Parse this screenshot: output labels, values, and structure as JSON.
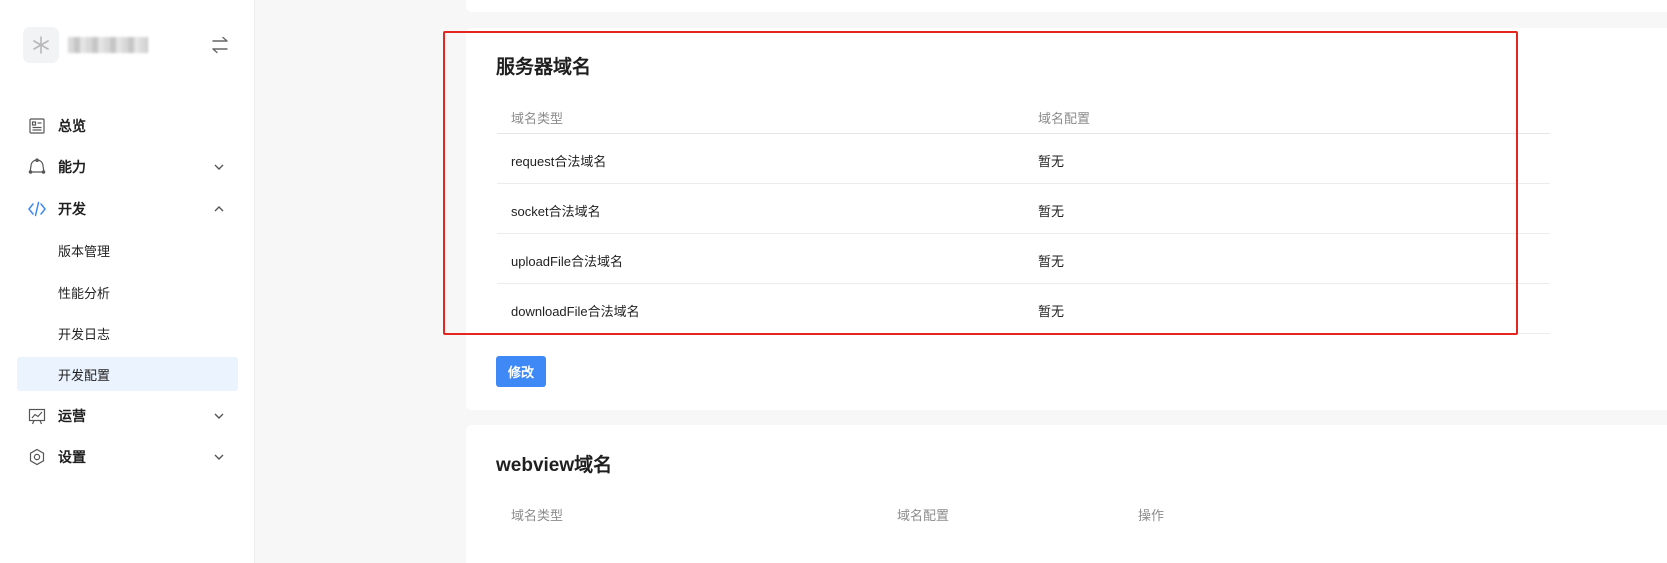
{
  "sidebar": {
    "items": [
      {
        "label": "总览",
        "icon": "dashboard-icon"
      },
      {
        "label": "能力",
        "icon": "capability-icon"
      },
      {
        "label": "开发",
        "icon": "code-icon"
      },
      {
        "label": "运营",
        "icon": "chart-icon"
      },
      {
        "label": "设置",
        "icon": "settings-icon"
      }
    ],
    "dev_sub": [
      {
        "label": "版本管理"
      },
      {
        "label": "性能分析"
      },
      {
        "label": "开发日志"
      },
      {
        "label": "开发配置"
      }
    ]
  },
  "server_domain": {
    "title": "服务器域名",
    "columns": [
      "域名类型",
      "域名配置"
    ],
    "rows": [
      {
        "type": "request合法域名",
        "config": "暂无"
      },
      {
        "type": "socket合法域名",
        "config": "暂无"
      },
      {
        "type": "uploadFile合法域名",
        "config": "暂无"
      },
      {
        "type": "downloadFile合法域名",
        "config": "暂无"
      }
    ],
    "edit_label": "修改"
  },
  "webview_domain": {
    "title": "webview域名",
    "columns": [
      "域名类型",
      "域名配置",
      "操作"
    ]
  },
  "colors": {
    "accent": "#3e89f5",
    "highlight": "#e5251f",
    "active_bg": "#ebf3fe"
  }
}
